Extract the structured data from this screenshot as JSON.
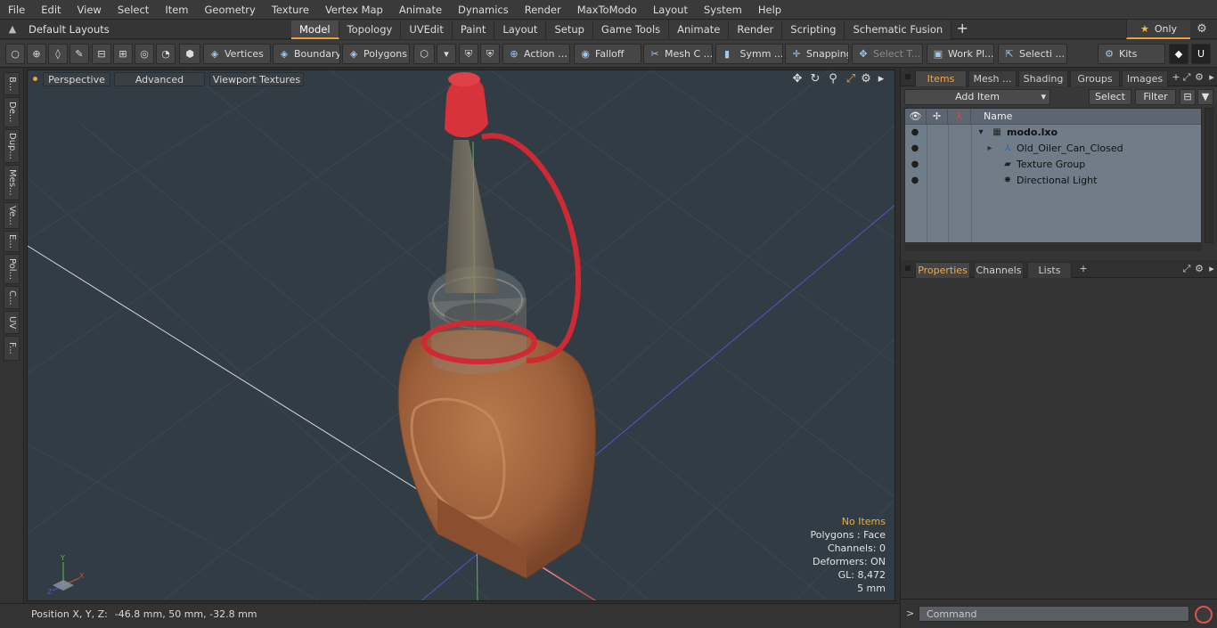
{
  "menu": [
    "File",
    "Edit",
    "View",
    "Select",
    "Item",
    "Geometry",
    "Texture",
    "Vertex Map",
    "Animate",
    "Dynamics",
    "Render",
    "MaxToModo",
    "Layout",
    "System",
    "Help"
  ],
  "layouts": {
    "label": "Default Layouts ▾"
  },
  "tabs": [
    "Model",
    "Topology",
    "UVEdit",
    "Paint",
    "Layout",
    "Setup",
    "Game Tools",
    "Animate",
    "Render",
    "Scripting",
    "Schematic Fusion"
  ],
  "active_tab": "Model",
  "only_label": "Only",
  "toolbar": {
    "vertices": "Vertices",
    "boundary": "Boundary",
    "polygons": "Polygons",
    "action": "Action",
    "falloff": "Falloff",
    "mesh_c": "Mesh C ...",
    "symm": "Symm ...",
    "snapping": "Snapping",
    "select_t": "Select T...",
    "work_pl": "Work Pl...",
    "selecti": "Selecti ...",
    "kits": "Kits"
  },
  "left_strip": [
    "B...",
    "De...",
    "Dup...",
    "Mes...",
    "Ve...",
    "E...",
    "Pol...",
    "C...",
    "UV",
    "F..."
  ],
  "viewport": {
    "perspective": "Perspective",
    "advanced": "Advanced",
    "viewport_textures": "Viewport Textures",
    "stats": {
      "no_items": "No Items",
      "polygons": "Polygons : Face",
      "channels": "Channels: 0",
      "deformers": "Deformers: ON",
      "gl": "GL: 8,472",
      "unit": "5 mm"
    },
    "axes": {
      "x": "X",
      "y": "Y",
      "z": "Z"
    }
  },
  "status": {
    "label": "Position X, Y, Z:",
    "value": "-46.8 mm, 50 mm, -32.8 mm"
  },
  "items_panel": {
    "tabs": [
      "Items",
      "Mesh ...",
      "Shading",
      "Groups",
      "Images"
    ],
    "add_item": "Add Item",
    "select": "Select",
    "filter": "Filter",
    "name_header": "Name",
    "rows": [
      {
        "label": "modo.lxo"
      },
      {
        "label": "Old_Oiler_Can_Closed"
      },
      {
        "label": "Texture Group"
      },
      {
        "label": "Directional Light"
      }
    ]
  },
  "properties_panel": {
    "tabs": [
      "Properties",
      "Channels",
      "Lists"
    ]
  },
  "command": {
    "placeholder": "Command"
  }
}
